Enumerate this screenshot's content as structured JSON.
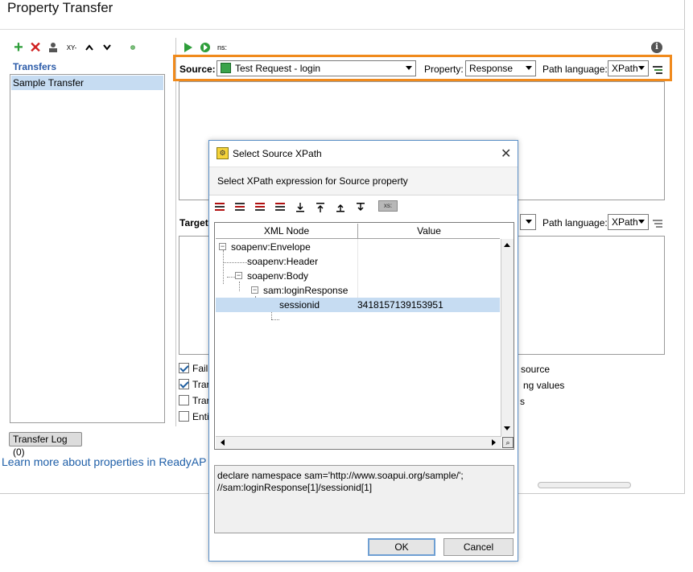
{
  "window": {
    "title": "Property Transfer",
    "transfers_header": "Transfers",
    "transfers": [
      "Sample Transfer"
    ],
    "transfer_log_tab": "Transfer Log (0)",
    "learn_more_link": "Learn more about properties in ReadyAP",
    "toolbar_left_xy_label": "XY-",
    "toolbar_right_ns_label": "ns:",
    "info_label": "i"
  },
  "source_row": {
    "source_label": "Source:",
    "source_value": "Test Request - login",
    "property_label": "Property:",
    "property_value": "Response",
    "path_language_label": "Path language:",
    "path_language_value": "XPath",
    "highlight_color": "#f08a1c"
  },
  "target_row": {
    "target_label": "Target",
    "path_language_label": "Path language:",
    "path_language_value": "XPath"
  },
  "options": [
    {
      "left_label": "Fail",
      "checked": true,
      "right_label": "source"
    },
    {
      "left_label": "Trar",
      "checked": true,
      "right_label": "ng values"
    },
    {
      "left_label": "Trar",
      "checked": false,
      "right_label": "s"
    },
    {
      "left_label": "Enti",
      "checked": false,
      "right_label": ""
    }
  ],
  "dialog": {
    "title": "Select Source XPath",
    "close_glyph": "✕",
    "description": "Select XPath expression for Source property",
    "xs_badge": "xs:",
    "columns": {
      "node": "XML Node",
      "value": "Value"
    },
    "tree": [
      {
        "node": "soapenv:Envelope",
        "value": "",
        "selected": false
      },
      {
        "node": "soapenv:Header",
        "value": "",
        "selected": false
      },
      {
        "node": "soapenv:Body",
        "value": "",
        "selected": false
      },
      {
        "node": "sam:loginResponse",
        "value": "",
        "selected": false
      },
      {
        "node": "sessionid",
        "value": "3418157139153951",
        "selected": true
      }
    ],
    "expression_lines": [
      "declare namespace sam='http://www.soapui.org/sample/';",
      "//sam:loginResponse[1]/sessionid[1]"
    ],
    "ok_label": "OK",
    "cancel_label": "Cancel"
  },
  "colors": {
    "add_icon": "#2e9e3a",
    "delete_icon": "#d02020",
    "run_icon": "#2e9e3a",
    "selection": "#c6dcf2",
    "link": "#1f5fa8"
  }
}
